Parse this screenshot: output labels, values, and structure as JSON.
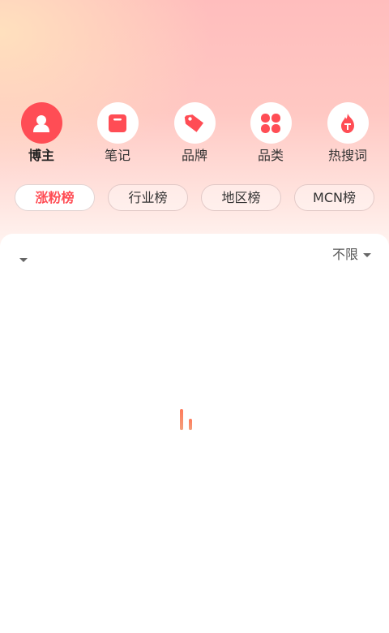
{
  "categories": [
    {
      "label": "博主",
      "icon": "blogger-icon",
      "active": true
    },
    {
      "label": "笔记",
      "icon": "note-icon",
      "active": false
    },
    {
      "label": "品牌",
      "icon": "brand-tag-icon",
      "active": false
    },
    {
      "label": "品类",
      "icon": "category-clover-icon",
      "active": false
    },
    {
      "label": "热搜词",
      "icon": "hot-search-icon",
      "active": false
    }
  ],
  "tabs": [
    {
      "label": "涨粉榜",
      "active": true
    },
    {
      "label": "行业榜",
      "active": false
    },
    {
      "label": "地区榜",
      "active": false
    },
    {
      "label": "MCN榜",
      "active": false
    }
  ],
  "filters": {
    "left_label": "",
    "right_label": "不限"
  },
  "colors": {
    "accent": "#ff4d55",
    "loader": "#ff7a5a"
  },
  "loading": true
}
